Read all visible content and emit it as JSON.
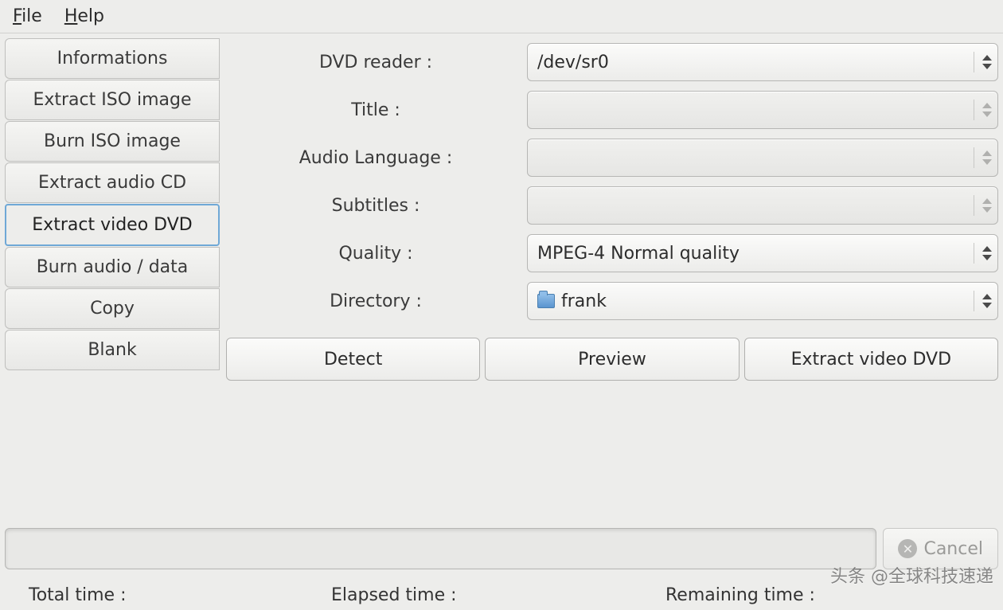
{
  "menubar": {
    "file": "File",
    "help": "Help"
  },
  "sidebar": {
    "tabs": [
      {
        "label": "Informations"
      },
      {
        "label": "Extract ISO image"
      },
      {
        "label": "Burn ISO image"
      },
      {
        "label": "Extract audio CD"
      },
      {
        "label": "Extract video DVD"
      },
      {
        "label": "Burn audio / data"
      },
      {
        "label": "Copy"
      },
      {
        "label": "Blank"
      }
    ],
    "selected_index": 4
  },
  "form": {
    "dvd_reader": {
      "label": "DVD reader :",
      "value": "/dev/sr0"
    },
    "title": {
      "label": "Title :",
      "value": ""
    },
    "audio_lang": {
      "label": "Audio Language :",
      "value": ""
    },
    "subtitles": {
      "label": "Subtitles :",
      "value": ""
    },
    "quality": {
      "label": "Quality :",
      "value": "MPEG-4 Normal quality"
    },
    "directory": {
      "label": "Directory :",
      "value": "frank"
    }
  },
  "buttons": {
    "detect": "Detect",
    "preview": "Preview",
    "extract": "Extract video DVD",
    "cancel": "Cancel"
  },
  "status": {
    "total_label": "Total time :",
    "elapsed_label": "Elapsed time :",
    "remaining_label": "Remaining time :"
  },
  "watermark": "头条 @全球科技速递"
}
